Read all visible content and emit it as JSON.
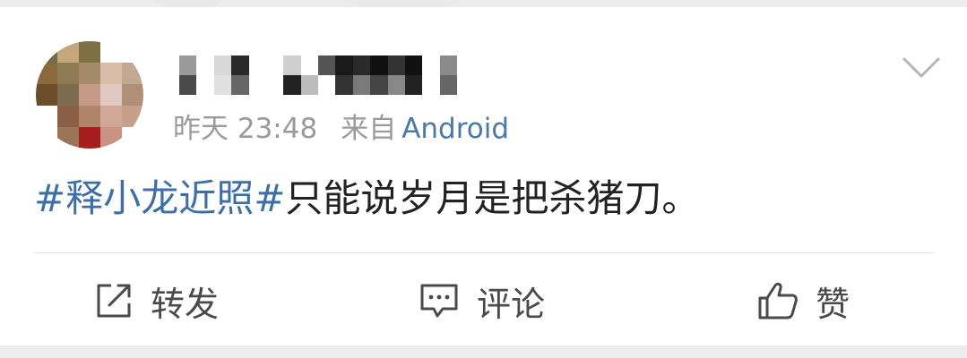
{
  "post": {
    "time": "昨天 23:48",
    "source_prefix": "来自",
    "source_device": "Android",
    "topic": "#释小龙近照#",
    "text": "只能说岁月是把杀猪刀。"
  },
  "actions": {
    "repost_label": "转发",
    "comment_label": "评论",
    "like_label": "赞"
  },
  "icons": {
    "repost": "share-edit-icon",
    "comment": "comment-bubble-icon",
    "like": "thumbs-up-icon",
    "menu": "chevron-down-icon"
  },
  "colors": {
    "topic": "#3d6ea5",
    "device": "#4a78a8",
    "meta": "#9a9a9a",
    "text": "#222222"
  }
}
